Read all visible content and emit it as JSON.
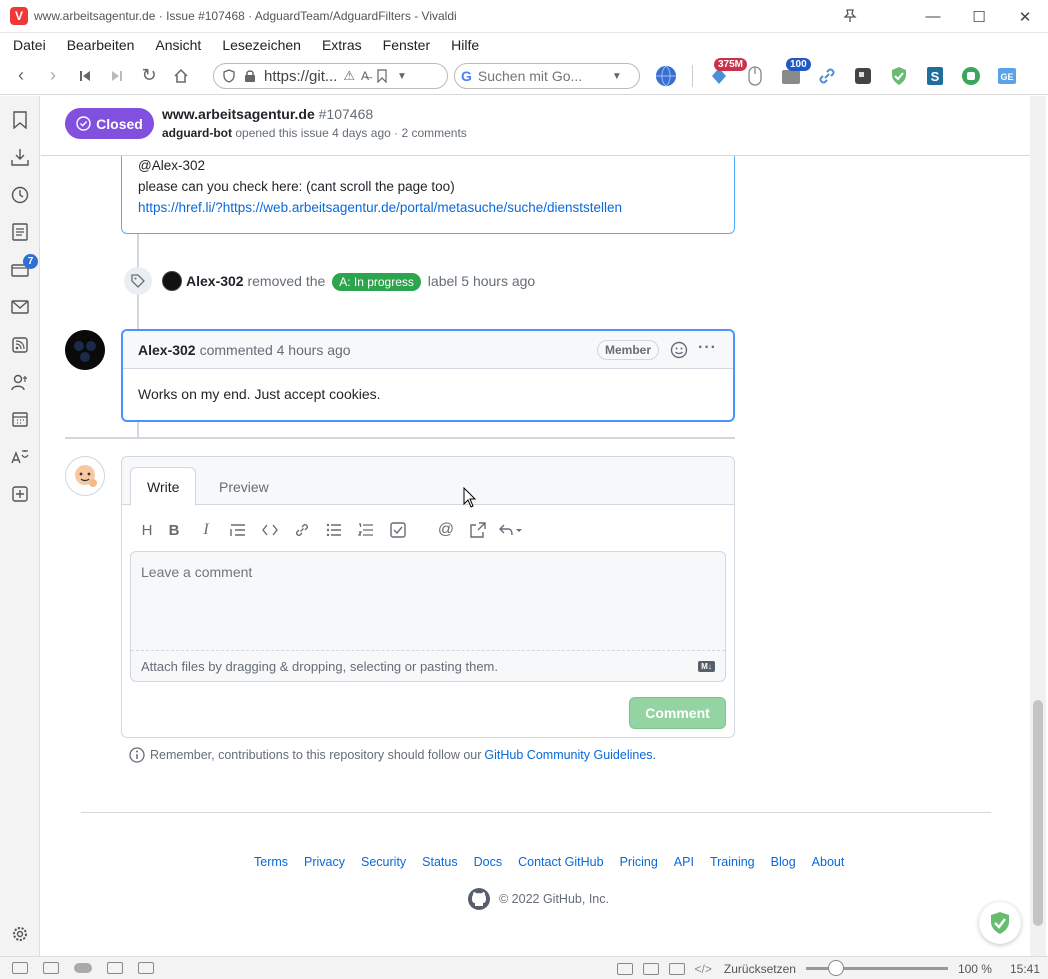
{
  "window": {
    "title": "www.arbeitsagentur.de · Issue #107468 · AdguardTeam/AdguardFilters - Vivaldi",
    "minimize": "—",
    "maximize": "☐",
    "close": "✕"
  },
  "menu": [
    "Datei",
    "Bearbeiten",
    "Ansicht",
    "Lesezeichen",
    "Extras",
    "Fenster",
    "Hilfe"
  ],
  "navbar": {
    "url": "https://git...",
    "search_placeholder": "Suchen mit Go...",
    "badge_mb": "375M",
    "badge_count": "100"
  },
  "sidebar": {
    "mail_badge": "7"
  },
  "issue": {
    "status": "Closed",
    "title": "www.arbeitsagentur.de",
    "number": "#107468",
    "author": "adguard-bot",
    "meta": "opened this issue 4 days ago · 2 comments"
  },
  "previous_comment": {
    "mention": "@Alex-302",
    "text": "please can you check here: (cant scroll the page too)",
    "link": "https://href.li/?https://web.arbeitsagentur.de/portal/metasuche/suche/dienststellen"
  },
  "event": {
    "actor": "Alex-302",
    "action": "removed the",
    "label": "A: In progress",
    "suffix": "label 5 hours ago"
  },
  "comment": {
    "author": "Alex-302",
    "time": "commented 4 hours ago",
    "role": "Member",
    "more": "···",
    "body": "Works on my end. Just accept cookies."
  },
  "form": {
    "tab_write": "Write",
    "tab_preview": "Preview",
    "placeholder": "Leave a comment",
    "attach": "Attach files by dragging & dropping, selecting or pasting them.",
    "md": "M↓",
    "submit": "Comment"
  },
  "guideline": {
    "text": "Remember, contributions to this repository should follow our",
    "link": "GitHub Community Guidelines."
  },
  "footer": {
    "links": [
      "Terms",
      "Privacy",
      "Security",
      "Status",
      "Docs",
      "Contact GitHub",
      "Pricing",
      "API",
      "Training",
      "Blog",
      "About"
    ],
    "copyright": "© 2022 GitHub, Inc."
  },
  "statusbar": {
    "reset": "Zurücksetzen",
    "zoom": "100 %",
    "time": "15:41"
  },
  "colors": {
    "closed": "#8250df",
    "label": "#2da44e",
    "link": "#0969da",
    "focus_border": "#4a94ff"
  }
}
